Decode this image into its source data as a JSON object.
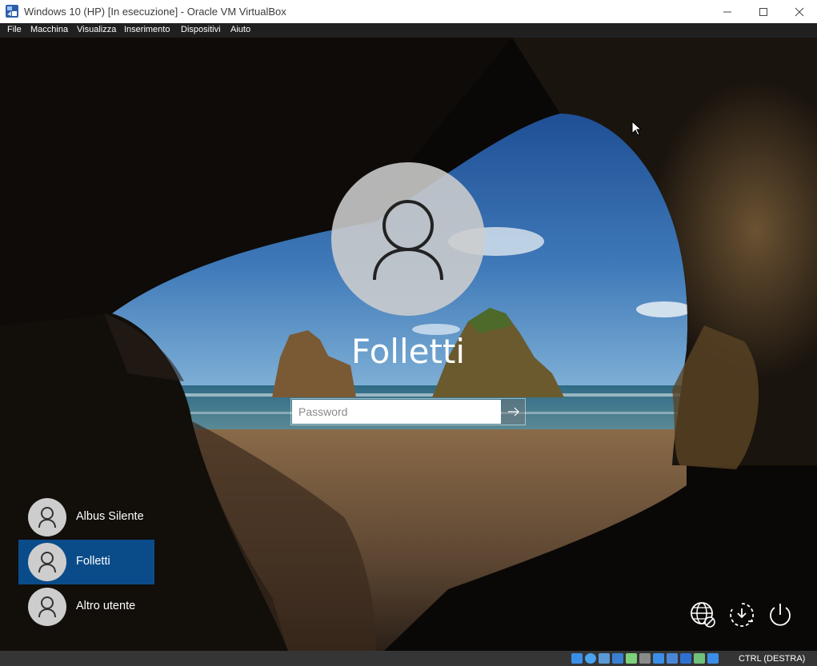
{
  "window": {
    "title": "Windows 10 (HP) [In esecuzione] - Oracle VM VirtualBox",
    "controls": {
      "minimize_icon": "minimize-icon",
      "maximize_icon": "maximize-icon",
      "close_icon": "close-icon"
    }
  },
  "menu": {
    "items": [
      {
        "label": "File"
      },
      {
        "label": "Macchina"
      },
      {
        "label": "Visualizza"
      },
      {
        "label": "Inserimento"
      },
      {
        "label": "Dispositivi"
      },
      {
        "label": "Aiuto"
      }
    ]
  },
  "login": {
    "selected_user": "Folletti",
    "password_placeholder": "Password",
    "submit_icon": "arrow-right-icon",
    "users": [
      {
        "name": "Albus Silente",
        "selected": false
      },
      {
        "name": "Folletti",
        "selected": true
      },
      {
        "name": "Altro utente",
        "selected": false
      }
    ],
    "system_buttons": [
      {
        "icon": "network-icon"
      },
      {
        "icon": "accessibility-icon"
      },
      {
        "icon": "power-icon"
      }
    ]
  },
  "statusbar": {
    "host_key": "CTRL (DESTRA)",
    "icons": [
      "hard-disk-icon",
      "optical-drive-icon",
      "audio-icon",
      "network-adapter-icon",
      "usb-icon",
      "shared-folders-icon",
      "display-icon",
      "recording-icon",
      "virtualization-icon",
      "mouse-integration-icon",
      "keyboard-icon"
    ]
  },
  "colors": {
    "selected_tile": "#0a4c8a",
    "menubar": "#202020",
    "statusbar": "#353535"
  }
}
